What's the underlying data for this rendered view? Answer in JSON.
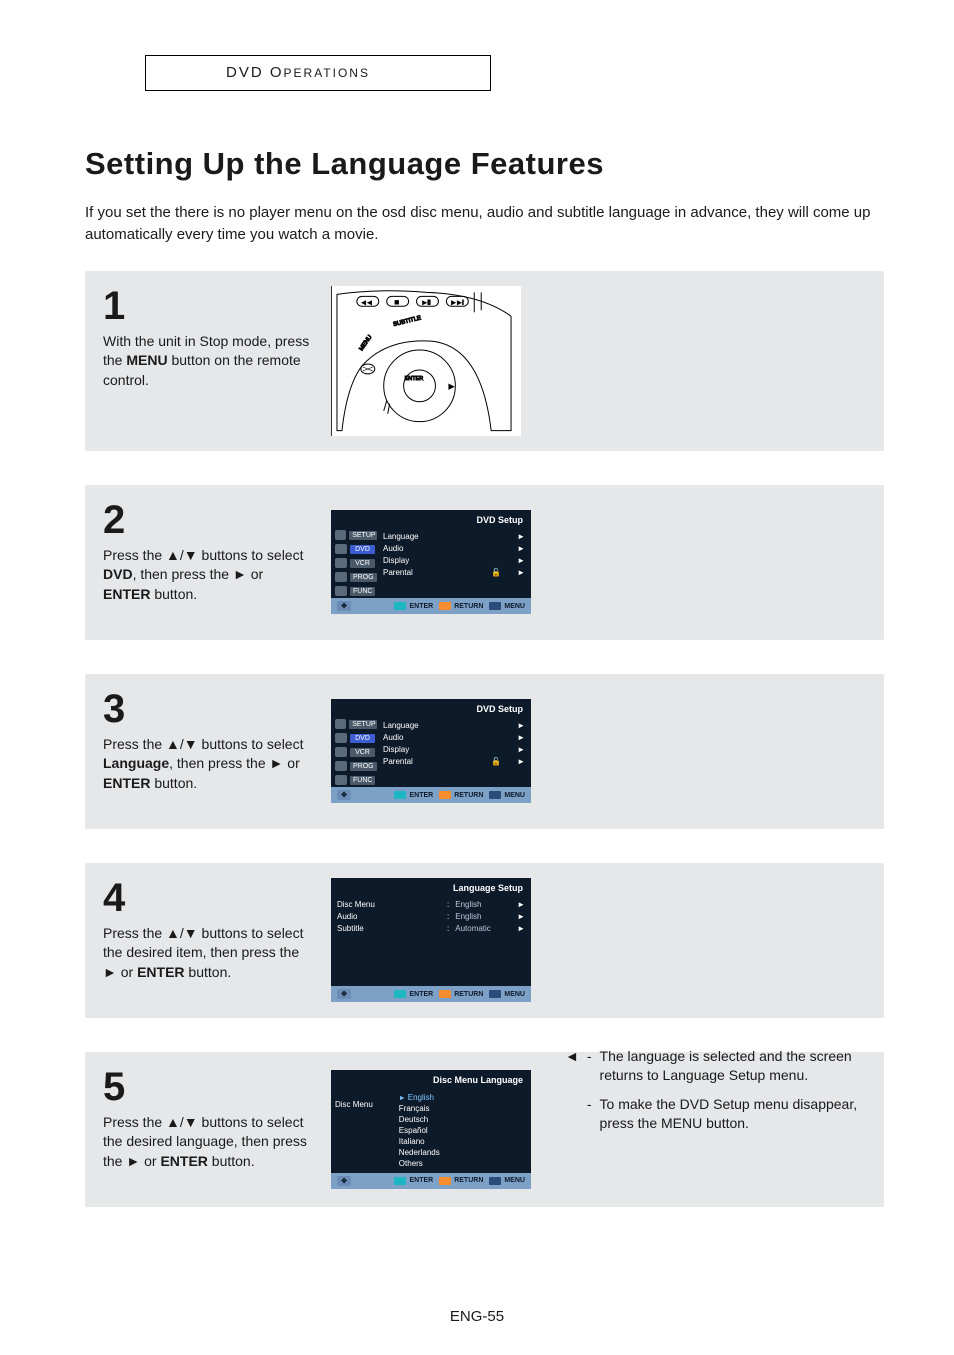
{
  "header": {
    "title_caps": "DVD O",
    "title_sc": "PERATIONS",
    "full": "DVD OPERATIONS"
  },
  "title": "Setting Up the Language Features",
  "intro": "If you set the there is no player menu on the osd disc menu, audio and subtitle language in advance, they will come up automatically every time you watch a movie.",
  "steps": [
    {
      "num": "1",
      "text_before": "With the unit in Stop mode, press the ",
      "bold1": "MENU",
      "text_after": " button on the remote control."
    },
    {
      "num": "2",
      "text_a": "Press the ",
      "arrows": "▲/▼",
      "text_b": " buttons to select ",
      "bold1": "DVD",
      "text_c": ", then press the ",
      "tri": "►",
      "text_d": " or ",
      "bold2": "ENTER",
      "text_e": " button."
    },
    {
      "num": "3",
      "text_a": "Press the ",
      "arrows": "▲/▼",
      "text_b": " buttons to select ",
      "bold1": "Language",
      "text_c": ", then press the ",
      "tri": "►",
      "text_d": " or ",
      "bold2": "ENTER",
      "text_e": " button."
    },
    {
      "num": "4",
      "text_a": "Press the ",
      "arrows": "▲/▼",
      "text_b": " buttons to select the desired item, then press the ",
      "tri": "►",
      "text_d": " or ",
      "bold2": "ENTER",
      "text_e": " button."
    },
    {
      "num": "5",
      "text_a": "Press the ",
      "arrows": "▲/▼",
      "text_b": " buttons to select the desired language, then press the ",
      "tri": "►",
      "text_d": " or ",
      "bold2": "ENTER",
      "text_e": " button."
    }
  ],
  "osd_setup": {
    "title": "DVD Setup",
    "side": [
      "SETUP",
      "DVD",
      "VCR",
      "PROG",
      "FUNC"
    ],
    "main": [
      {
        "label": "Language",
        "icon": ""
      },
      {
        "label": "Audio",
        "icon": ""
      },
      {
        "label": "Display",
        "icon": ""
      },
      {
        "label": "Parental",
        "icon": "lock"
      }
    ],
    "footer": {
      "enter": "ENTER",
      "return": "RETURN",
      "menu": "MENU"
    }
  },
  "osd_lang_setup": {
    "title": "Language Setup",
    "rows": [
      {
        "label": "Disc Menu",
        "value": "English"
      },
      {
        "label": "Audio",
        "value": "English"
      },
      {
        "label": "Subtitle",
        "value": "Automatic"
      }
    ]
  },
  "osd_disc_menu": {
    "title": "Disc Menu Language",
    "left_label": "Disc Menu",
    "languages": [
      "English",
      "Français",
      "Deutsch",
      "Español",
      "Italiano",
      "Nederlands",
      "Others"
    ]
  },
  "notes": {
    "n1": "The language is selected and the screen returns to Language Setup menu.",
    "n2": "To make the DVD Setup menu disappear, press the MENU button."
  },
  "remote_labels": {
    "subtitle": "SUBTITLE",
    "menu": "MENU",
    "enter": "ENTER"
  },
  "page_num": "ENG-55"
}
